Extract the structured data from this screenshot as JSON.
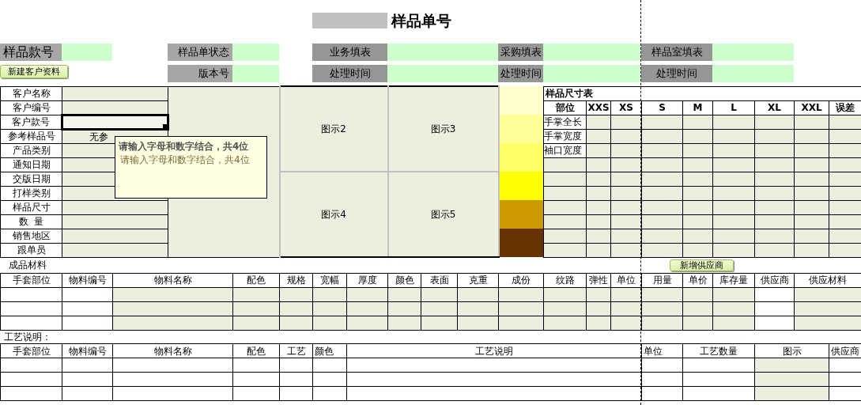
{
  "title": "样品单号",
  "header": {
    "style_no_label": "样品款号",
    "new_customer_button": "新建客户资料",
    "groups": [
      {
        "top": "样品单状态",
        "bottom": "版本号"
      },
      {
        "top": "业务填表",
        "bottom": "处理时间"
      },
      {
        "top": "采购填表",
        "bottom": "处理时间"
      },
      {
        "top": "样品室填表",
        "bottom": "处理时间"
      }
    ]
  },
  "customer_fields": [
    {
      "label": "客户名称",
      "selected": false
    },
    {
      "label": "客户编号",
      "selected": false
    },
    {
      "label": "客户款号",
      "selected": true
    },
    {
      "label": "参考样品号",
      "value": "无参",
      "selected": false
    },
    {
      "label": "产品类别",
      "selected": false
    },
    {
      "label": "通知日期",
      "selected": false
    },
    {
      "label": "交版日期",
      "selected": false
    },
    {
      "label": "打样类别",
      "selected": false
    },
    {
      "label": "样品尺寸",
      "selected": false
    },
    {
      "label": "数  量",
      "selected": false
    },
    {
      "label": "销售地区",
      "selected": false
    },
    {
      "label": "跟单员",
      "selected": false
    }
  ],
  "diagrams": [
    "图示2",
    "图示3",
    "图示4",
    "图示5"
  ],
  "swatches": [
    {
      "color": "#ffffcc"
    },
    {
      "color": "#ffff99"
    },
    {
      "color": "#ffff66"
    },
    {
      "color": "#ffff00"
    },
    {
      "color": "#cc9900"
    },
    {
      "color": "#663300"
    }
  ],
  "size_table": {
    "title": "样品尺寸表",
    "columns": [
      "部位",
      "XXS",
      "XS",
      "S",
      "M",
      "L",
      "XL",
      "XXL",
      "误差"
    ],
    "parts": [
      "手掌全长",
      "手掌宽度",
      "袖口宽度"
    ]
  },
  "tooltip": {
    "title": "请输入字母和数字结合，共4位",
    "text": "请输入字母和数字结合，共4位"
  },
  "materials": {
    "label": "成品材料",
    "add_supplier_button": "新增供应商",
    "columns": [
      "手套部位",
      "物料编号",
      "物料名称",
      "配色",
      "规格",
      "宽幅",
      "厚度",
      "颜色",
      "表面",
      "克重",
      "成份",
      "纹路",
      "弹性",
      "单位",
      "用量",
      "单价",
      "库存量",
      "供应商",
      "供应材料"
    ]
  },
  "process": {
    "label": "工艺说明：",
    "columns": [
      "手套部位",
      "物料编号",
      "物料名称",
      "配色",
      "工艺",
      "颜色",
      "工艺说明",
      "单位",
      "工艺数量",
      "图示",
      "供应商"
    ]
  }
}
